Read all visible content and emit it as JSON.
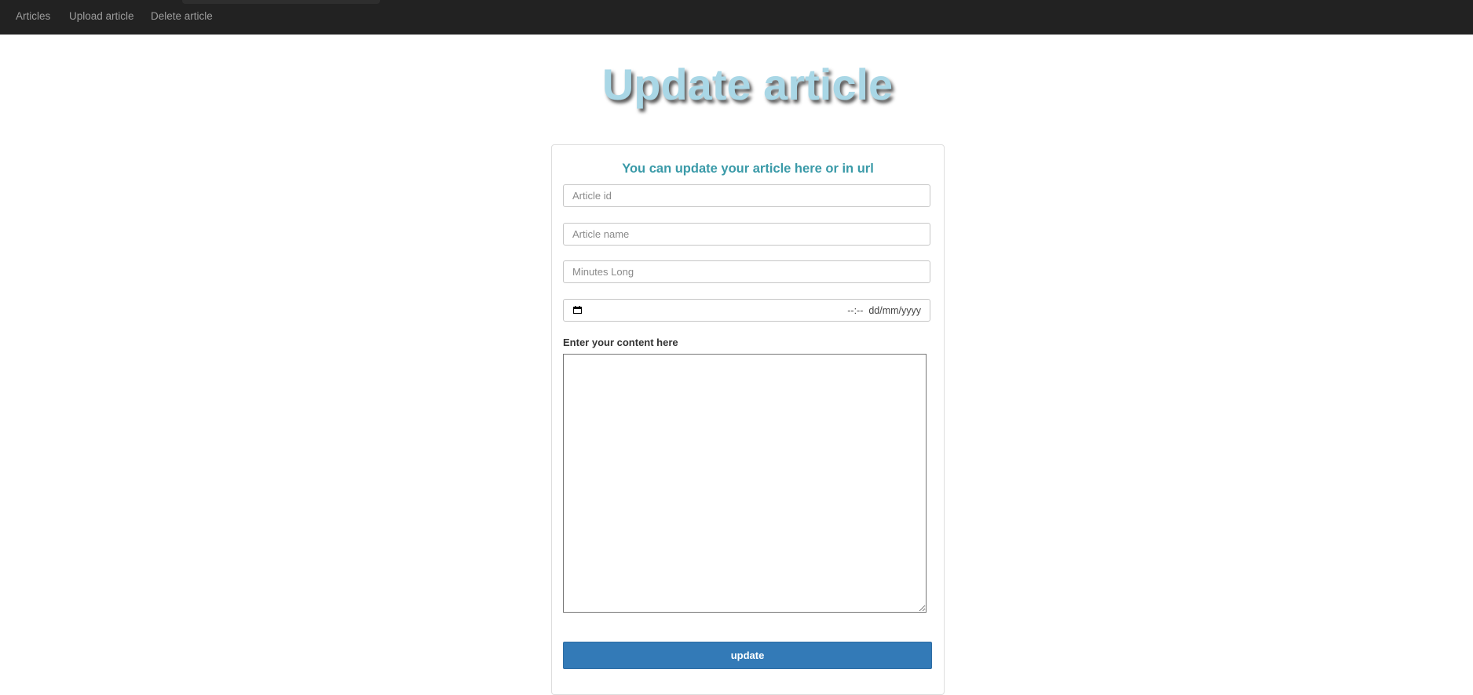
{
  "navbar": {
    "links": [
      "Articles",
      "Upload article",
      "Delete article"
    ]
  },
  "page": {
    "title": "Update article"
  },
  "form": {
    "heading": "You can update your article here or in url",
    "article_id": {
      "placeholder": "Article id",
      "value": ""
    },
    "article_name": {
      "placeholder": "Article name",
      "value": ""
    },
    "minutes_long": {
      "placeholder": "Minutes Long",
      "value": ""
    },
    "date": {
      "placeholder": "--:--  dd/mm/yyyy",
      "icon": "calendar-icon"
    },
    "content_label": "Enter your content here",
    "content_value": "",
    "submit_label": "update"
  },
  "colors": {
    "navbar_bg": "#222222",
    "nav_link": "#9d9d9d",
    "title": "#a9d7e6",
    "heading": "#3a9aa8",
    "button": "#337ab7"
  }
}
